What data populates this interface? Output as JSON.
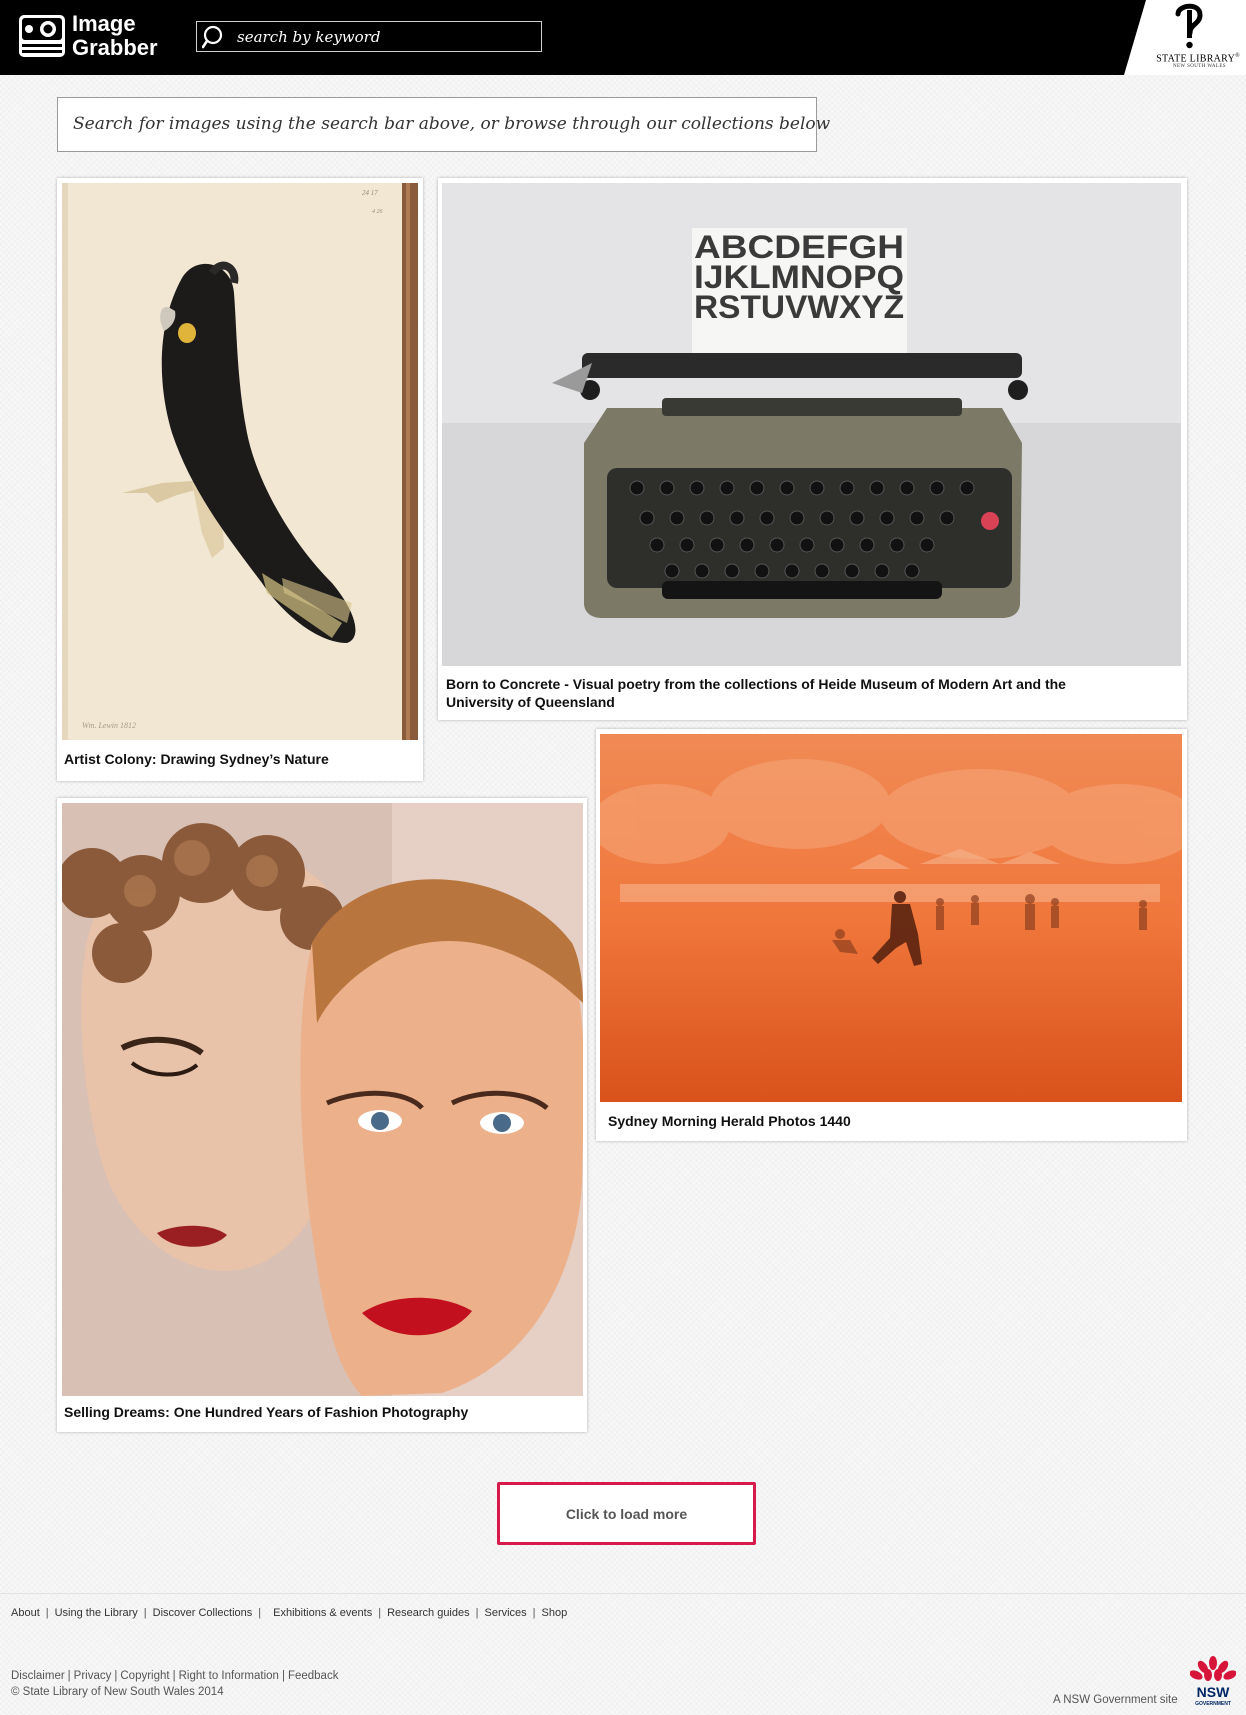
{
  "header": {
    "logo_line1": "Image",
    "logo_line2": "Grabber",
    "search_placeholder": "search by keyword",
    "library_name": "STATE LIBRARY",
    "library_mark": "®",
    "library_sub": "NEW SOUTH WALES"
  },
  "intro": {
    "text": "Search for images using the search bar above, or browse through our collections below"
  },
  "collections": [
    {
      "title": "Artist Colony: Drawing Sydney’s Nature",
      "image": "black-cockatoo-illustration"
    },
    {
      "title": "Born to Concrete - Visual poetry from the collections of Heide Museum of Modern Art and the University of Queensland",
      "image": "typewriter-photo",
      "paper_line1": "ABCDEFGH",
      "paper_line2": "IJKLMNOPQ",
      "paper_line3": "RSTUVWXYZ"
    },
    {
      "title": "Sydney Morning Herald Photos 1440",
      "image": "dust-storm-photo"
    },
    {
      "title": "Selling Dreams: One Hundred Years of Fashion Photography",
      "image": "two-faces-photo"
    }
  ],
  "load_more": {
    "label": "Click to load more"
  },
  "footer": {
    "nav": [
      "About",
      "Using the Library",
      "Discover Collections",
      "Exhibitions & events",
      "Research guides",
      "Services",
      "Shop"
    ],
    "legal": [
      "Disclaimer",
      "Privacy",
      "Copyright",
      "Right to Information",
      "Feedback"
    ],
    "copyright": "© State Library of New South Wales 2014",
    "gov_text": "A NSW Government site",
    "gov_logo_text": "NSW",
    "gov_logo_sub": "GOVERNMENT"
  },
  "colors": {
    "header_bg": "#000000",
    "accent": "#d7194c",
    "page_bg": "#f7f7f7",
    "nsw_red": "#d7153a",
    "nsw_blue": "#002664"
  }
}
